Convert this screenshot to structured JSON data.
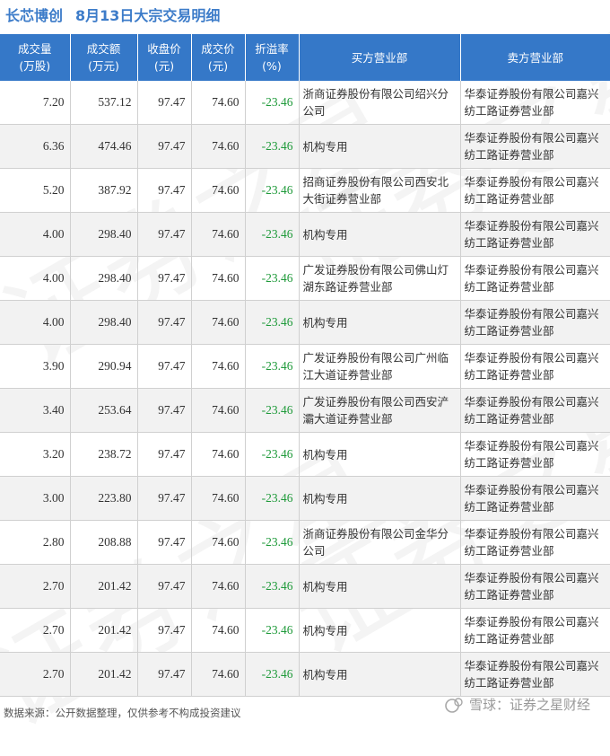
{
  "title": {
    "stock": "长芯博创",
    "subtitle": "8月13日大宗交易明细"
  },
  "headers": [
    "成交量\n(万股)",
    "成交额\n(万元)",
    "收盘价\n(元)",
    "成交价\n(元)",
    "折溢率\n(%)",
    "买方营业部",
    "卖方营业部"
  ],
  "rows": [
    [
      "7.20",
      "537.12",
      "97.47",
      "74.60",
      "-23.46",
      "浙商证券股份有限公司绍兴分公司",
      "华泰证券股份有限公司嘉兴纺工路证券营业部"
    ],
    [
      "6.36",
      "474.46",
      "97.47",
      "74.60",
      "-23.46",
      "机构专用",
      "华泰证券股份有限公司嘉兴纺工路证券营业部"
    ],
    [
      "5.20",
      "387.92",
      "97.47",
      "74.60",
      "-23.46",
      "招商证券股份有限公司西安北大街证券营业部",
      "华泰证券股份有限公司嘉兴纺工路证券营业部"
    ],
    [
      "4.00",
      "298.40",
      "97.47",
      "74.60",
      "-23.46",
      "机构专用",
      "华泰证券股份有限公司嘉兴纺工路证券营业部"
    ],
    [
      "4.00",
      "298.40",
      "97.47",
      "74.60",
      "-23.46",
      "广发证券股份有限公司佛山灯湖东路证券营业部",
      "华泰证券股份有限公司嘉兴纺工路证券营业部"
    ],
    [
      "4.00",
      "298.40",
      "97.47",
      "74.60",
      "-23.46",
      "机构专用",
      "华泰证券股份有限公司嘉兴纺工路证券营业部"
    ],
    [
      "3.90",
      "290.94",
      "97.47",
      "74.60",
      "-23.46",
      "广发证券股份有限公司广州临江大道证券营业部",
      "华泰证券股份有限公司嘉兴纺工路证券营业部"
    ],
    [
      "3.40",
      "253.64",
      "97.47",
      "74.60",
      "-23.46",
      "广发证券股份有限公司西安浐灞大道证券营业部",
      "华泰证券股份有限公司嘉兴纺工路证券营业部"
    ],
    [
      "3.20",
      "238.72",
      "97.47",
      "74.60",
      "-23.46",
      "机构专用",
      "华泰证券股份有限公司嘉兴纺工路证券营业部"
    ],
    [
      "3.00",
      "223.80",
      "97.47",
      "74.60",
      "-23.46",
      "机构专用",
      "华泰证券股份有限公司嘉兴纺工路证券营业部"
    ],
    [
      "2.80",
      "208.88",
      "97.47",
      "74.60",
      "-23.46",
      "浙商证券股份有限公司金华分公司",
      "华泰证券股份有限公司嘉兴纺工路证券营业部"
    ],
    [
      "2.70",
      "201.42",
      "97.47",
      "74.60",
      "-23.46",
      "机构专用",
      "华泰证券股份有限公司嘉兴纺工路证券营业部"
    ],
    [
      "2.70",
      "201.42",
      "97.47",
      "74.60",
      "-23.46",
      "机构专用",
      "华泰证券股份有限公司嘉兴纺工路证券营业部"
    ],
    [
      "2.70",
      "201.42",
      "97.47",
      "74.60",
      "-23.46",
      "机构专用",
      "华泰证券股份有限公司嘉兴纺工路证券营业部"
    ]
  ],
  "footer": "数据来源：公开数据整理，仅供参考不构成投资建议",
  "brand": {
    "icon": "snowball-icon",
    "text": "雪球：证券之星财经"
  },
  "watermark": "证券之星",
  "colors": {
    "header_bg": "#3578c8",
    "title": "#3d7cc9",
    "negative": "#1f9a3a",
    "row_alt": "#f2f2f2"
  }
}
